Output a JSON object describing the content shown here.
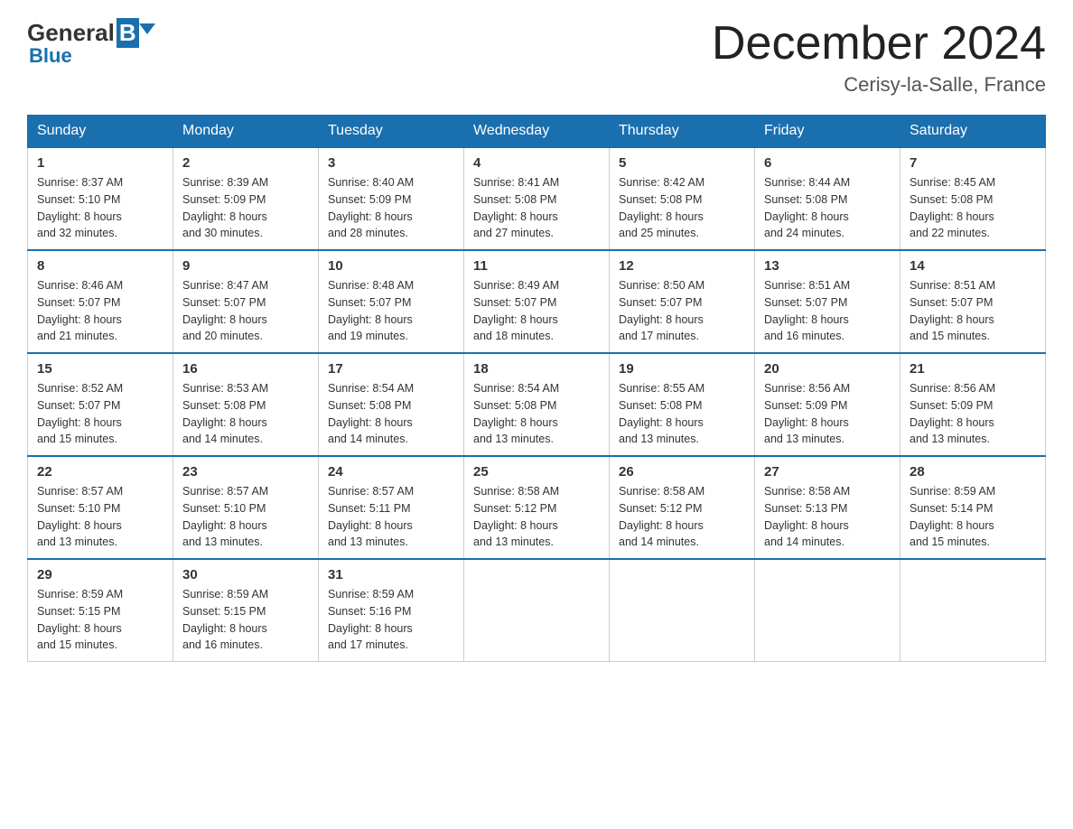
{
  "header": {
    "logo": {
      "general": "General",
      "blue": "Blue"
    },
    "title": "December 2024",
    "location": "Cerisy-la-Salle, France"
  },
  "days_of_week": [
    "Sunday",
    "Monday",
    "Tuesday",
    "Wednesday",
    "Thursday",
    "Friday",
    "Saturday"
  ],
  "weeks": [
    [
      {
        "day": "1",
        "sunrise": "Sunrise: 8:37 AM",
        "sunset": "Sunset: 5:10 PM",
        "daylight": "Daylight: 8 hours",
        "daylight2": "and 32 minutes."
      },
      {
        "day": "2",
        "sunrise": "Sunrise: 8:39 AM",
        "sunset": "Sunset: 5:09 PM",
        "daylight": "Daylight: 8 hours",
        "daylight2": "and 30 minutes."
      },
      {
        "day": "3",
        "sunrise": "Sunrise: 8:40 AM",
        "sunset": "Sunset: 5:09 PM",
        "daylight": "Daylight: 8 hours",
        "daylight2": "and 28 minutes."
      },
      {
        "day": "4",
        "sunrise": "Sunrise: 8:41 AM",
        "sunset": "Sunset: 5:08 PM",
        "daylight": "Daylight: 8 hours",
        "daylight2": "and 27 minutes."
      },
      {
        "day": "5",
        "sunrise": "Sunrise: 8:42 AM",
        "sunset": "Sunset: 5:08 PM",
        "daylight": "Daylight: 8 hours",
        "daylight2": "and 25 minutes."
      },
      {
        "day": "6",
        "sunrise": "Sunrise: 8:44 AM",
        "sunset": "Sunset: 5:08 PM",
        "daylight": "Daylight: 8 hours",
        "daylight2": "and 24 minutes."
      },
      {
        "day": "7",
        "sunrise": "Sunrise: 8:45 AM",
        "sunset": "Sunset: 5:08 PM",
        "daylight": "Daylight: 8 hours",
        "daylight2": "and 22 minutes."
      }
    ],
    [
      {
        "day": "8",
        "sunrise": "Sunrise: 8:46 AM",
        "sunset": "Sunset: 5:07 PM",
        "daylight": "Daylight: 8 hours",
        "daylight2": "and 21 minutes."
      },
      {
        "day": "9",
        "sunrise": "Sunrise: 8:47 AM",
        "sunset": "Sunset: 5:07 PM",
        "daylight": "Daylight: 8 hours",
        "daylight2": "and 20 minutes."
      },
      {
        "day": "10",
        "sunrise": "Sunrise: 8:48 AM",
        "sunset": "Sunset: 5:07 PM",
        "daylight": "Daylight: 8 hours",
        "daylight2": "and 19 minutes."
      },
      {
        "day": "11",
        "sunrise": "Sunrise: 8:49 AM",
        "sunset": "Sunset: 5:07 PM",
        "daylight": "Daylight: 8 hours",
        "daylight2": "and 18 minutes."
      },
      {
        "day": "12",
        "sunrise": "Sunrise: 8:50 AM",
        "sunset": "Sunset: 5:07 PM",
        "daylight": "Daylight: 8 hours",
        "daylight2": "and 17 minutes."
      },
      {
        "day": "13",
        "sunrise": "Sunrise: 8:51 AM",
        "sunset": "Sunset: 5:07 PM",
        "daylight": "Daylight: 8 hours",
        "daylight2": "and 16 minutes."
      },
      {
        "day": "14",
        "sunrise": "Sunrise: 8:51 AM",
        "sunset": "Sunset: 5:07 PM",
        "daylight": "Daylight: 8 hours",
        "daylight2": "and 15 minutes."
      }
    ],
    [
      {
        "day": "15",
        "sunrise": "Sunrise: 8:52 AM",
        "sunset": "Sunset: 5:07 PM",
        "daylight": "Daylight: 8 hours",
        "daylight2": "and 15 minutes."
      },
      {
        "day": "16",
        "sunrise": "Sunrise: 8:53 AM",
        "sunset": "Sunset: 5:08 PM",
        "daylight": "Daylight: 8 hours",
        "daylight2": "and 14 minutes."
      },
      {
        "day": "17",
        "sunrise": "Sunrise: 8:54 AM",
        "sunset": "Sunset: 5:08 PM",
        "daylight": "Daylight: 8 hours",
        "daylight2": "and 14 minutes."
      },
      {
        "day": "18",
        "sunrise": "Sunrise: 8:54 AM",
        "sunset": "Sunset: 5:08 PM",
        "daylight": "Daylight: 8 hours",
        "daylight2": "and 13 minutes."
      },
      {
        "day": "19",
        "sunrise": "Sunrise: 8:55 AM",
        "sunset": "Sunset: 5:08 PM",
        "daylight": "Daylight: 8 hours",
        "daylight2": "and 13 minutes."
      },
      {
        "day": "20",
        "sunrise": "Sunrise: 8:56 AM",
        "sunset": "Sunset: 5:09 PM",
        "daylight": "Daylight: 8 hours",
        "daylight2": "and 13 minutes."
      },
      {
        "day": "21",
        "sunrise": "Sunrise: 8:56 AM",
        "sunset": "Sunset: 5:09 PM",
        "daylight": "Daylight: 8 hours",
        "daylight2": "and 13 minutes."
      }
    ],
    [
      {
        "day": "22",
        "sunrise": "Sunrise: 8:57 AM",
        "sunset": "Sunset: 5:10 PM",
        "daylight": "Daylight: 8 hours",
        "daylight2": "and 13 minutes."
      },
      {
        "day": "23",
        "sunrise": "Sunrise: 8:57 AM",
        "sunset": "Sunset: 5:10 PM",
        "daylight": "Daylight: 8 hours",
        "daylight2": "and 13 minutes."
      },
      {
        "day": "24",
        "sunrise": "Sunrise: 8:57 AM",
        "sunset": "Sunset: 5:11 PM",
        "daylight": "Daylight: 8 hours",
        "daylight2": "and 13 minutes."
      },
      {
        "day": "25",
        "sunrise": "Sunrise: 8:58 AM",
        "sunset": "Sunset: 5:12 PM",
        "daylight": "Daylight: 8 hours",
        "daylight2": "and 13 minutes."
      },
      {
        "day": "26",
        "sunrise": "Sunrise: 8:58 AM",
        "sunset": "Sunset: 5:12 PM",
        "daylight": "Daylight: 8 hours",
        "daylight2": "and 14 minutes."
      },
      {
        "day": "27",
        "sunrise": "Sunrise: 8:58 AM",
        "sunset": "Sunset: 5:13 PM",
        "daylight": "Daylight: 8 hours",
        "daylight2": "and 14 minutes."
      },
      {
        "day": "28",
        "sunrise": "Sunrise: 8:59 AM",
        "sunset": "Sunset: 5:14 PM",
        "daylight": "Daylight: 8 hours",
        "daylight2": "and 15 minutes."
      }
    ],
    [
      {
        "day": "29",
        "sunrise": "Sunrise: 8:59 AM",
        "sunset": "Sunset: 5:15 PM",
        "daylight": "Daylight: 8 hours",
        "daylight2": "and 15 minutes."
      },
      {
        "day": "30",
        "sunrise": "Sunrise: 8:59 AM",
        "sunset": "Sunset: 5:15 PM",
        "daylight": "Daylight: 8 hours",
        "daylight2": "and 16 minutes."
      },
      {
        "day": "31",
        "sunrise": "Sunrise: 8:59 AM",
        "sunset": "Sunset: 5:16 PM",
        "daylight": "Daylight: 8 hours",
        "daylight2": "and 17 minutes."
      },
      null,
      null,
      null,
      null
    ]
  ]
}
